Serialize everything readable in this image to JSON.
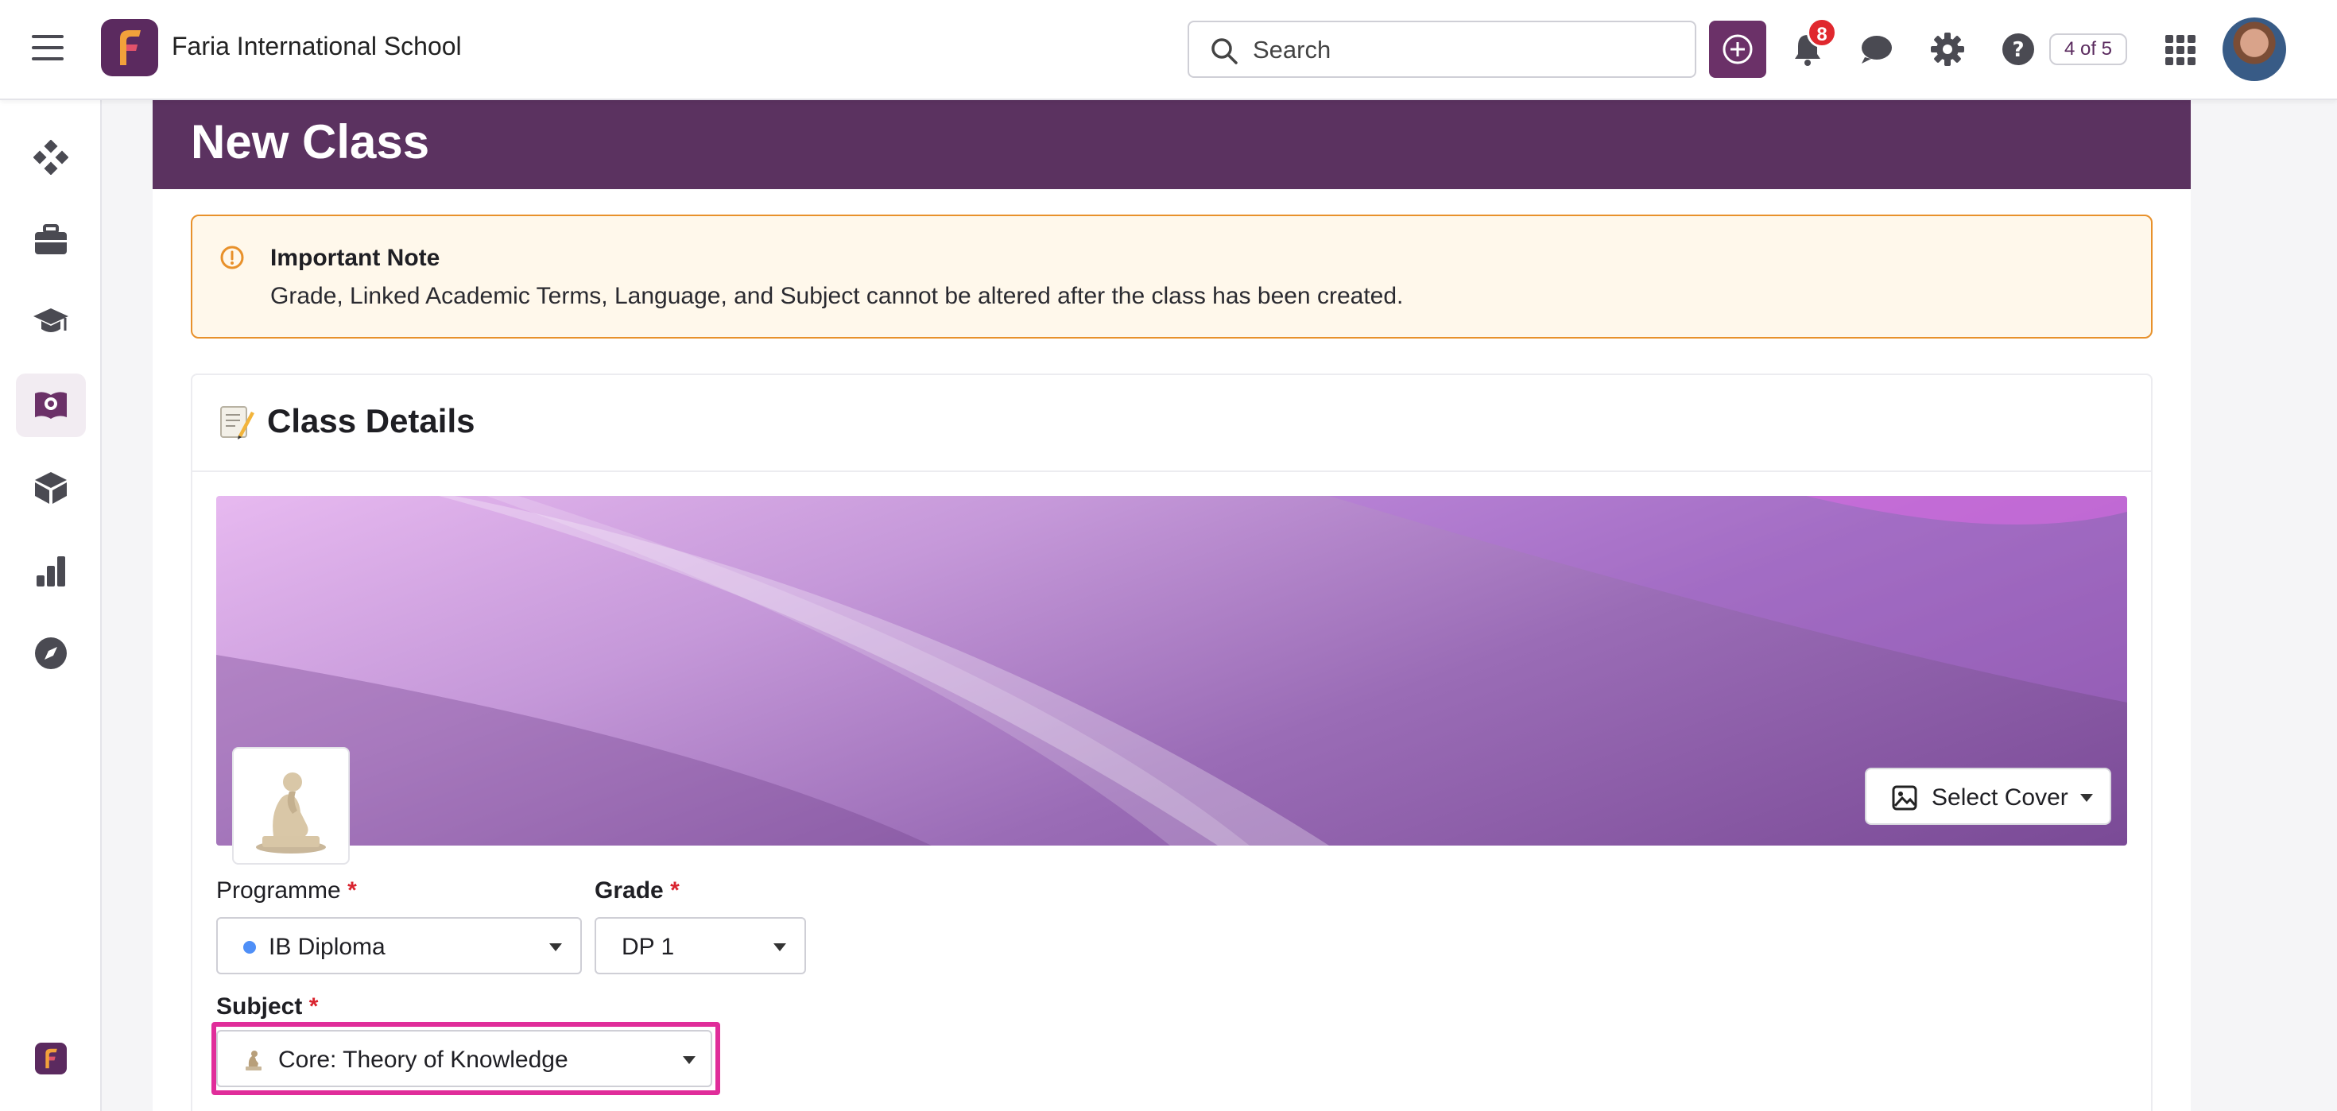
{
  "header": {
    "school_name": "Faria International School",
    "search_placeholder": "Search",
    "notification_count": "8",
    "pager": "4 of 5"
  },
  "page": {
    "title": "New Class"
  },
  "note": {
    "title": "Important Note",
    "text": "Grade, Linked Academic Terms, Language, and Subject cannot be altered after the class has been created."
  },
  "card": {
    "title": "Class Details",
    "select_cover_label": "Select Cover"
  },
  "form": {
    "programme": {
      "label": "Programme",
      "required": "*",
      "value": "IB Diploma"
    },
    "grade": {
      "label": "Grade",
      "required": "*",
      "value": "DP 1"
    },
    "subject": {
      "label": "Subject",
      "required": "*",
      "value": "Core:  Theory of Knowledge"
    }
  },
  "colors": {
    "brand": "#5b3260",
    "note_border": "#e8912b",
    "note_bg": "#fff8eb",
    "required": "#d9232e",
    "highlight": "#e02d9a",
    "programme_dot": "#4f8ff7"
  },
  "sidebar": {
    "items": [
      {
        "icon": "dashboard-diamond-icon"
      },
      {
        "icon": "briefcase-icon"
      },
      {
        "icon": "graduation-cap-icon"
      },
      {
        "icon": "book-icon",
        "active": true
      },
      {
        "icon": "cube-icon"
      },
      {
        "icon": "bar-chart-icon"
      },
      {
        "icon": "compass-icon"
      }
    ]
  }
}
